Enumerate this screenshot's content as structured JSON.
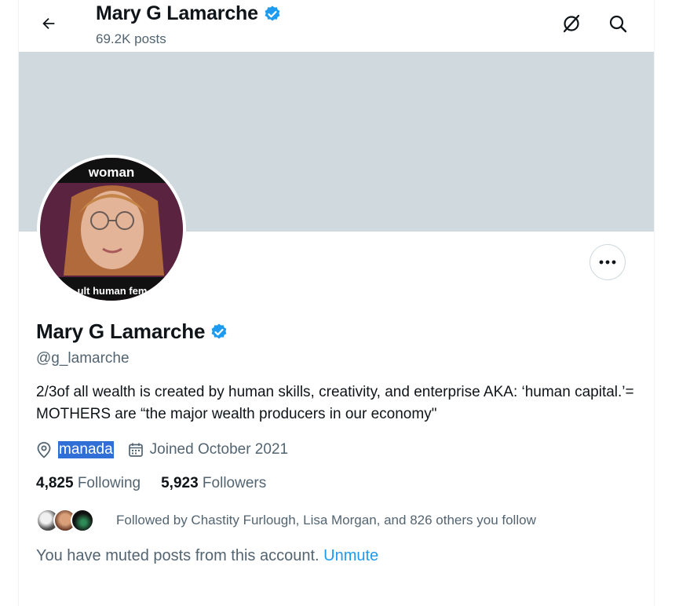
{
  "header": {
    "name": "Mary G Lamarche",
    "posts_count": "69.2K posts",
    "icons": [
      "back-arrow-icon",
      "verified-badge-icon",
      "grok-icon",
      "search-icon"
    ]
  },
  "profile": {
    "avatar_top_text": "woman",
    "avatar_bottom_text": "ult human fem",
    "display_name": "Mary G Lamarche",
    "handle": "@g_lamarche",
    "bio": "2/3of all wealth is created by human skills, creativity, and enterprise AKA: ‘human capital.’= MOTHERS are “the major wealth producers in our economy\"",
    "location": "manada",
    "joined": "Joined October 2021",
    "following_count": "4,825",
    "following_label": "Following",
    "followers_count": "5,923",
    "followers_label": "Followers",
    "followed_by": "Followed by Chastity Furlough, Lisa Morgan, and 826 others you follow",
    "muted_text": "You have muted posts from this account.",
    "unmute_label": "Unmute"
  },
  "colors": {
    "accent": "#1d9bf0",
    "banner": "#cfd9de",
    "secondary_text": "#536471",
    "selection": "#2f6fd6"
  }
}
